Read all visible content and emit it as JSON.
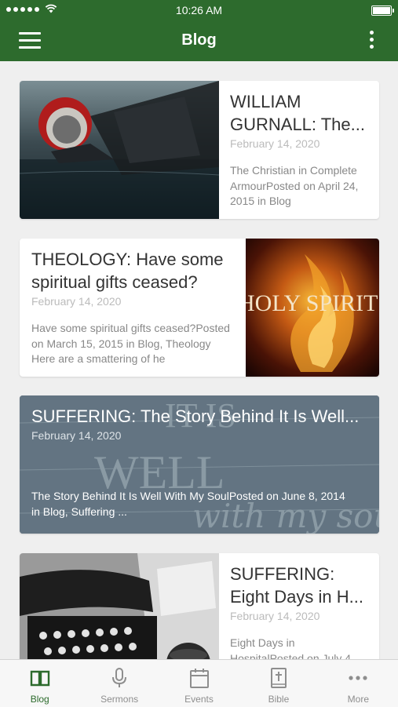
{
  "status_bar": {
    "time": "10:26 AM"
  },
  "header": {
    "title": "Blog"
  },
  "posts": [
    {
      "title": "WILLIAM GURNALL: The...",
      "date": "February 14, 2020",
      "excerpt": "The Christian in Complete ArmourPosted on April 24, 2015  in Blog"
    },
    {
      "title": "THEOLOGY: Have some spiritual gifts ceased?",
      "date": "February 14, 2020",
      "excerpt": "Have some spiritual gifts ceased?Posted on March 15, 2015  in Blog, Theology Here are a smattering of he"
    },
    {
      "title": "SUFFERING: The Story Behind It Is Well...",
      "date": "February 14, 2020",
      "excerpt": "The Story Behind It Is Well With My SoulPosted on June 8, 2014  in Blog, Suffering ...",
      "bg_words": [
        "IT IS",
        "WELL",
        "with my soul"
      ]
    },
    {
      "title": "SUFFERING: Eight Days in H...",
      "date": "February 14, 2020",
      "excerpt": "Eight Days in HospitalPosted on July 4"
    }
  ],
  "image_text": {
    "holy_spirit": "HOLY SPIRIT"
  },
  "tabs": [
    {
      "label": "Blog",
      "icon": "book-open-icon"
    },
    {
      "label": "Sermons",
      "icon": "microphone-icon"
    },
    {
      "label": "Events",
      "icon": "calendar-icon"
    },
    {
      "label": "Bible",
      "icon": "bible-icon"
    },
    {
      "label": "More",
      "icon": "more-dots-icon"
    }
  ],
  "colors": {
    "brand": "#2d6b2d",
    "tab_inactive": "#8e8e8e"
  }
}
